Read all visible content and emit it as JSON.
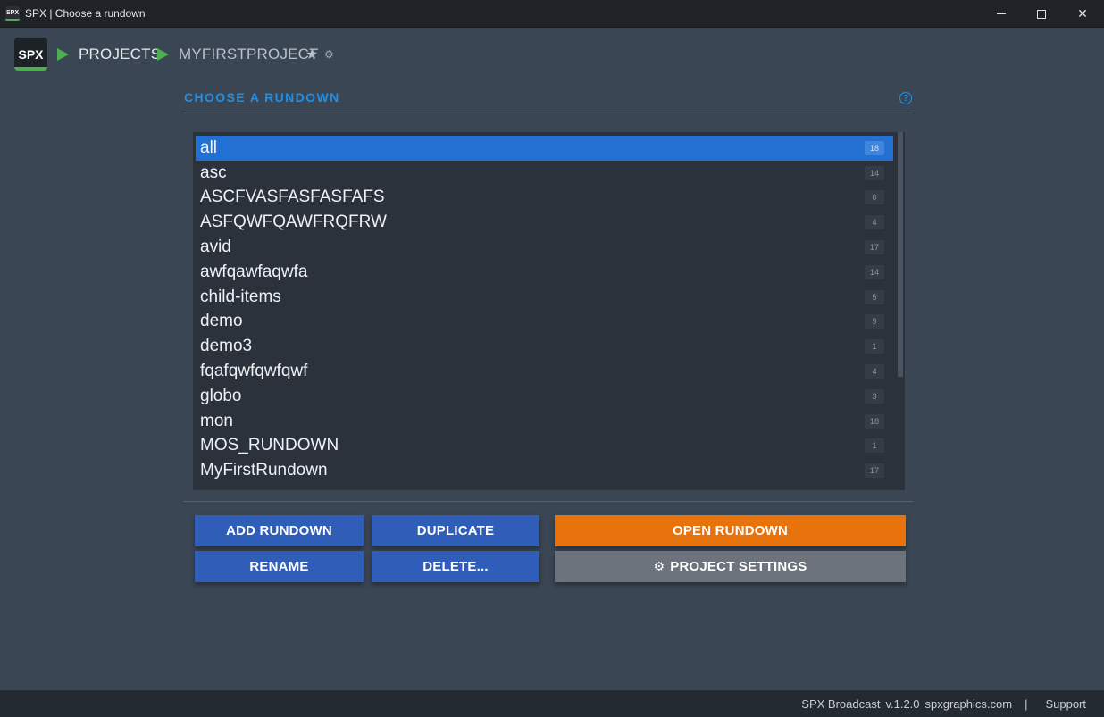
{
  "window": {
    "title": "SPX | Choose a rundown",
    "icon_text": "SPX"
  },
  "header": {
    "logo_text": "SPX",
    "breadcrumb": [
      "PROJECTS",
      "MYFIRSTPROJECT"
    ]
  },
  "section": {
    "title": "CHOOSE A RUNDOWN",
    "help_symbol": "?"
  },
  "rundowns": [
    {
      "name": "all",
      "count": "18",
      "selected": true
    },
    {
      "name": "asc",
      "count": "14"
    },
    {
      "name": "ASCFVASFASFASFAFS",
      "count": "0"
    },
    {
      "name": "ASFQWFQAWFRQFRW",
      "count": "4"
    },
    {
      "name": "avid",
      "count": "17"
    },
    {
      "name": "awfqawfaqwfa",
      "count": "14"
    },
    {
      "name": "child-items",
      "count": "5"
    },
    {
      "name": "demo",
      "count": "9"
    },
    {
      "name": "demo3",
      "count": "1"
    },
    {
      "name": "fqafqwfqwfqwf",
      "count": "4"
    },
    {
      "name": "globo",
      "count": "3"
    },
    {
      "name": "mon",
      "count": "18"
    },
    {
      "name": "MOS_RUNDOWN",
      "count": "1"
    },
    {
      "name": "MyFirstRundown",
      "count": "17"
    }
  ],
  "buttons": {
    "add": "ADD RUNDOWN",
    "duplicate": "DUPLICATE",
    "open": "OPEN RUNDOWN",
    "rename": "RENAME",
    "delete": "DELETE...",
    "settings": "PROJECT SETTINGS"
  },
  "footer": {
    "product": "SPX Broadcast",
    "version": "v.1.2.0",
    "site": "spxgraphics.com",
    "separator": "|",
    "support": "Support"
  },
  "colors": {
    "accent_blue": "#2370d3",
    "heading_blue": "#1e90e6",
    "button_blue": "#2f5db8",
    "button_orange": "#e8720c",
    "button_gray": "#6c737c",
    "arrow_green": "#4caf50"
  }
}
